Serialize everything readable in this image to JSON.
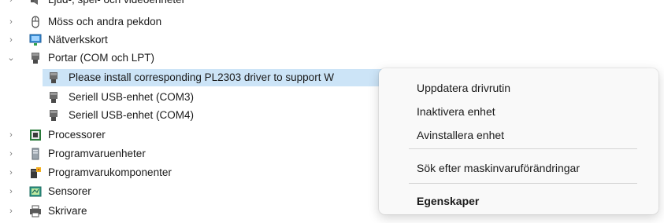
{
  "tree": {
    "items": [
      {
        "label": "Ljud-, spel- och videoenheter",
        "icon": "speaker-icon",
        "state": "collapsed"
      },
      {
        "label": "Möss och andra pekdon",
        "icon": "mouse-icon",
        "state": "collapsed"
      },
      {
        "label": "Nätverkskort",
        "icon": "network-adapter-icon",
        "state": "collapsed"
      },
      {
        "label": "Portar (COM och LPT)",
        "icon": "port-icon",
        "state": "expanded"
      },
      {
        "label": "Please install corresponding PL2303 driver to support W",
        "icon": "port-icon",
        "state": "child-selected"
      },
      {
        "label": "Seriell USB-enhet (COM3)",
        "icon": "port-icon",
        "state": "child"
      },
      {
        "label": "Seriell USB-enhet (COM4)",
        "icon": "port-icon",
        "state": "child"
      },
      {
        "label": "Processorer",
        "icon": "processor-icon",
        "state": "collapsed"
      },
      {
        "label": "Programvaruenheter",
        "icon": "software-device-icon",
        "state": "collapsed"
      },
      {
        "label": "Programvarukomponenter",
        "icon": "software-component-icon",
        "state": "collapsed"
      },
      {
        "label": "Sensorer",
        "icon": "sensor-icon",
        "state": "collapsed"
      },
      {
        "label": "Skrivare",
        "icon": "printer-icon",
        "state": "collapsed"
      }
    ]
  },
  "context_menu": {
    "update_driver": "Uppdatera drivrutin",
    "disable_device": "Inaktivera enhet",
    "uninstall_device": "Avinstallera enhet",
    "scan_hardware": "Sök efter maskinvaruförändringar",
    "properties": "Egenskaper"
  },
  "colors": {
    "selection": "#cce4f7",
    "menu_background": "#f9f9f9",
    "chevron": "#7a7a7a"
  }
}
